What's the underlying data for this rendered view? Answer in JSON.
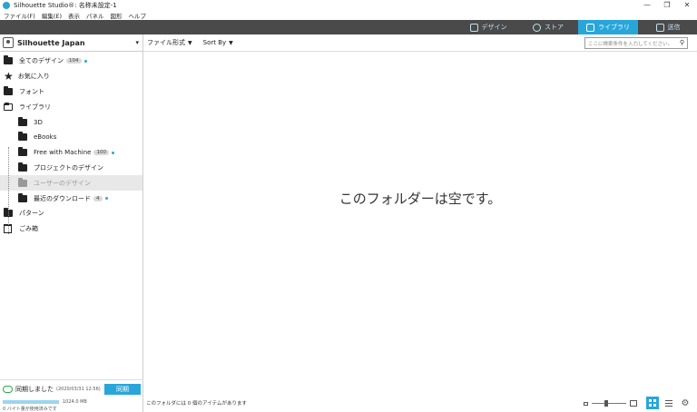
{
  "window": {
    "title": "Silhouette Studio®: 名称未設定-1",
    "controls": [
      "—",
      "❐",
      "✕"
    ]
  },
  "menu": [
    "ファイル(F)",
    "編集(E)",
    "表示",
    "パネル",
    "図形",
    "ヘルプ"
  ],
  "tabs": [
    {
      "label": "デザイン",
      "icon": "design-grid-icon",
      "active": false
    },
    {
      "label": "ストア",
      "icon": "store-globe-icon",
      "active": false
    },
    {
      "label": "ライブラリ",
      "icon": "library-download-icon",
      "active": true
    },
    {
      "label": "送信",
      "icon": "send-cutter-icon",
      "active": false
    }
  ],
  "account": {
    "name": "Silhouette Japan",
    "caret": "▾"
  },
  "tree": {
    "all_designs": {
      "label": "全てのデザイン",
      "count": "104"
    },
    "favorites": {
      "label": "お気に入り"
    },
    "fonts": {
      "label": "フォント"
    },
    "library": {
      "label": "ライブラリ"
    },
    "sub_3d": {
      "label": "3D"
    },
    "sub_ebooks": {
      "label": "eBooks"
    },
    "sub_free": {
      "label": "Free with Machine",
      "count": "100"
    },
    "sub_project": {
      "label": "プロジェクトのデザイン"
    },
    "sub_user": {
      "label": "ユーザーのデザイン"
    },
    "sub_recent": {
      "label": "最近のダウンロード",
      "count": "4"
    },
    "patterns": {
      "label": "パターン"
    },
    "trash": {
      "label": "ごみ箱"
    }
  },
  "sync": {
    "status": "同期しました",
    "timestamp": "(2020/03/31 12:56)",
    "button": "同期",
    "quota": "1024.0 MB",
    "used": "0 バイト量が使用済みです",
    "quota_used_fraction": 0
  },
  "toolbar": {
    "file_type": "ファイル形式",
    "sort_by": "Sort By",
    "search_placeholder": "ここに検索条件を入力してください。"
  },
  "main": {
    "empty_message": "このフォルダーは空です。"
  },
  "status": {
    "text": "このフォルダには 0 個のアイテムがあります"
  },
  "colors": {
    "accent": "#29a6d9",
    "topbar": "#4a4a4a"
  }
}
